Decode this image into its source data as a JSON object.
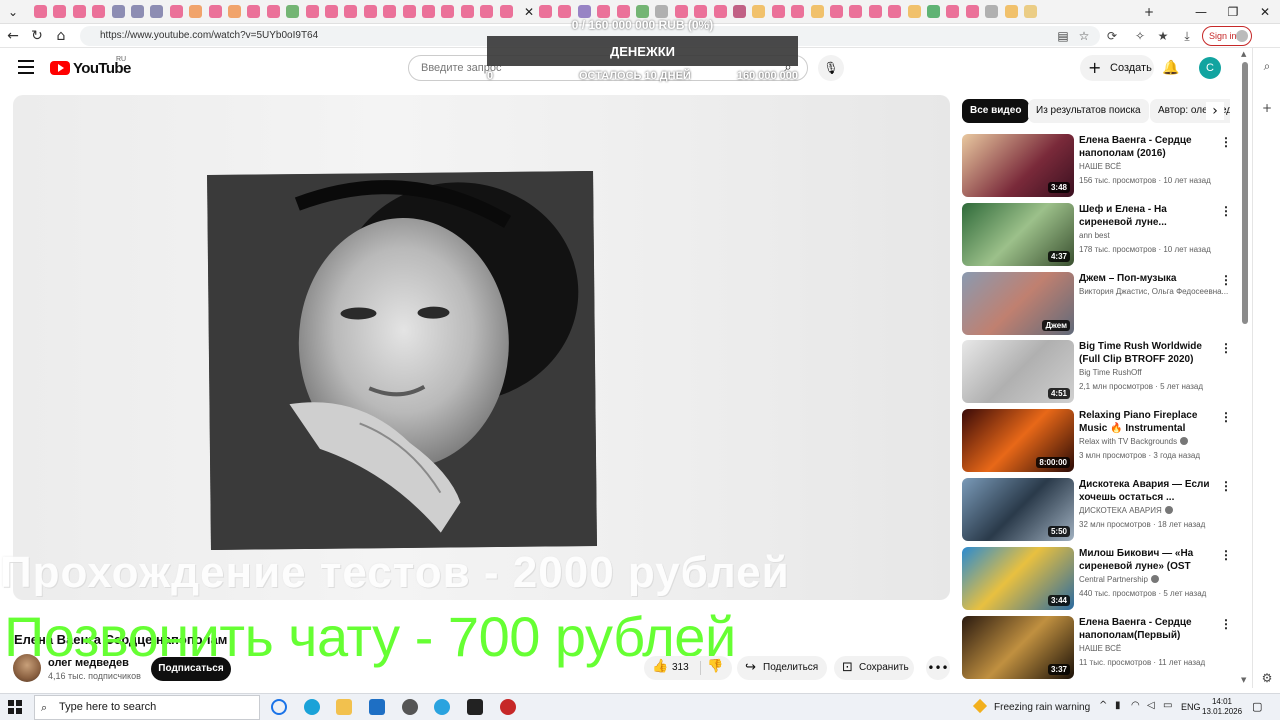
{
  "browser": {
    "url": "https://www.youtube.com/watch?v=5UYb0oI9T64",
    "signin_label": "Sign in",
    "tab_colors": [
      "#e8457b",
      "#e8457b",
      "#e8457b",
      "#e8457b",
      "#6b6b9e",
      "#6b6b9e",
      "#6b6b9e",
      "#e8457b",
      "#f08a3e",
      "#e8457b",
      "#f08a3e",
      "#e8457b",
      "#e8457b",
      "#4aa04a",
      "#e8457b",
      "#e8457b",
      "#e8457b",
      "#e8457b",
      "#e8457b",
      "#e8457b",
      "#e8457b",
      "#e8457b",
      "#e8457b",
      "#e8457b",
      "#e8457b",
      "#e8457b",
      "#e8457b",
      "#7a5fb5",
      "#e8457b",
      "#e8457b",
      "#4aa04a",
      "#999999",
      "#e8457b",
      "#e8457b",
      "#e8457b",
      "#b03060",
      "#f0b03e",
      "#e8457b",
      "#e8457b",
      "#f0b03e",
      "#e8457b",
      "#e8457b",
      "#e8457b",
      "#e8457b",
      "#f0b03e",
      "#2e9e4a",
      "#e8457b",
      "#e8457b",
      "#999999",
      "#f0b03e",
      "#e8c060"
    ]
  },
  "youtube": {
    "logo_text": "YouTube",
    "country_code": "RU",
    "search_placeholder": "Введите запрос",
    "create_label": "Создать",
    "avatar_letter": "С"
  },
  "overlay": {
    "goal_text": "0 / 160 000 000 RUB (0%)",
    "title": "ДЕНЕЖКИ",
    "min_value": "0",
    "remaining": "ОСТАЛОСЬ 10 ДНЕЙ",
    "max_value": "160 000 000",
    "promo_line1": "Прохождение тестов - 2000 рублей",
    "promo_line2": "Позвонить чату - 700 рублей"
  },
  "video": {
    "title": "Елена Ваенга Сердце напополам",
    "channel": "олег медведев",
    "subscribers": "4,16 тыс. подписчиков",
    "subscribe_label": "Подписаться",
    "likes": "313",
    "share_label": "Поделиться",
    "save_label": "Сохранить"
  },
  "chips": [
    "Все видео",
    "Из результатов поиска",
    "Автор: олег медведев"
  ],
  "recommendations": [
    {
      "title": "Елена Ваенга - Сердце напополам (2016)",
      "channel": "НАШЕ ВСЁ",
      "meta": "156 тыс. просмотров · 10 лет назад",
      "duration": "3:48",
      "verified": false
    },
    {
      "title": "Шеф и Елена - На сиреневой луне...",
      "channel": "ann best",
      "meta": "178 тыс. просмотров · 10 лет назад",
      "duration": "4:37",
      "verified": false
    },
    {
      "title": "Джем – Поп-музыка",
      "channel": "Виктория Джастис, Ольга Федосеевна...",
      "meta": "",
      "duration": "Джем",
      "verified": false
    },
    {
      "title": "Big Time Rush Worldwide (Full Clip BTROFF 2020)",
      "channel": "Big Time RushOff",
      "meta": "2,1 млн просмотров · 5 лет назад",
      "duration": "4:51",
      "verified": false
    },
    {
      "title": "Relaxing Piano Fireplace Music 🔥 Instrumental Fireplace ...",
      "channel": "Relax with TV Backgrounds",
      "meta": "3 млн просмотров · 3 года назад",
      "duration": "8:00:00",
      "verified": true
    },
    {
      "title": "Дискотека Авария — Если хочешь остаться ...",
      "channel": "ДИСКОТЕКА АВАРИЯ",
      "meta": "32 млн просмотров · 18 лет назад",
      "duration": "5:50",
      "verified": true
    },
    {
      "title": "Милош Бикович — «На сиреневой луне» (OST «Отел...",
      "channel": "Central Partnership",
      "meta": "440 тыс. просмотров · 5 лет назад",
      "duration": "3:44",
      "verified": true
    },
    {
      "title": "Елена Ваенга - Сердце напополам(Первый)",
      "channel": "НАШЕ ВСЁ",
      "meta": "11 тыс. просмотров · 11 лет назад",
      "duration": "3:37",
      "verified": false
    }
  ],
  "taskbar": {
    "search_placeholder": "Type here to search",
    "weather": "Freezing rain warning",
    "lang": "ENG",
    "time": "14:01",
    "date": "13.01.2026"
  }
}
